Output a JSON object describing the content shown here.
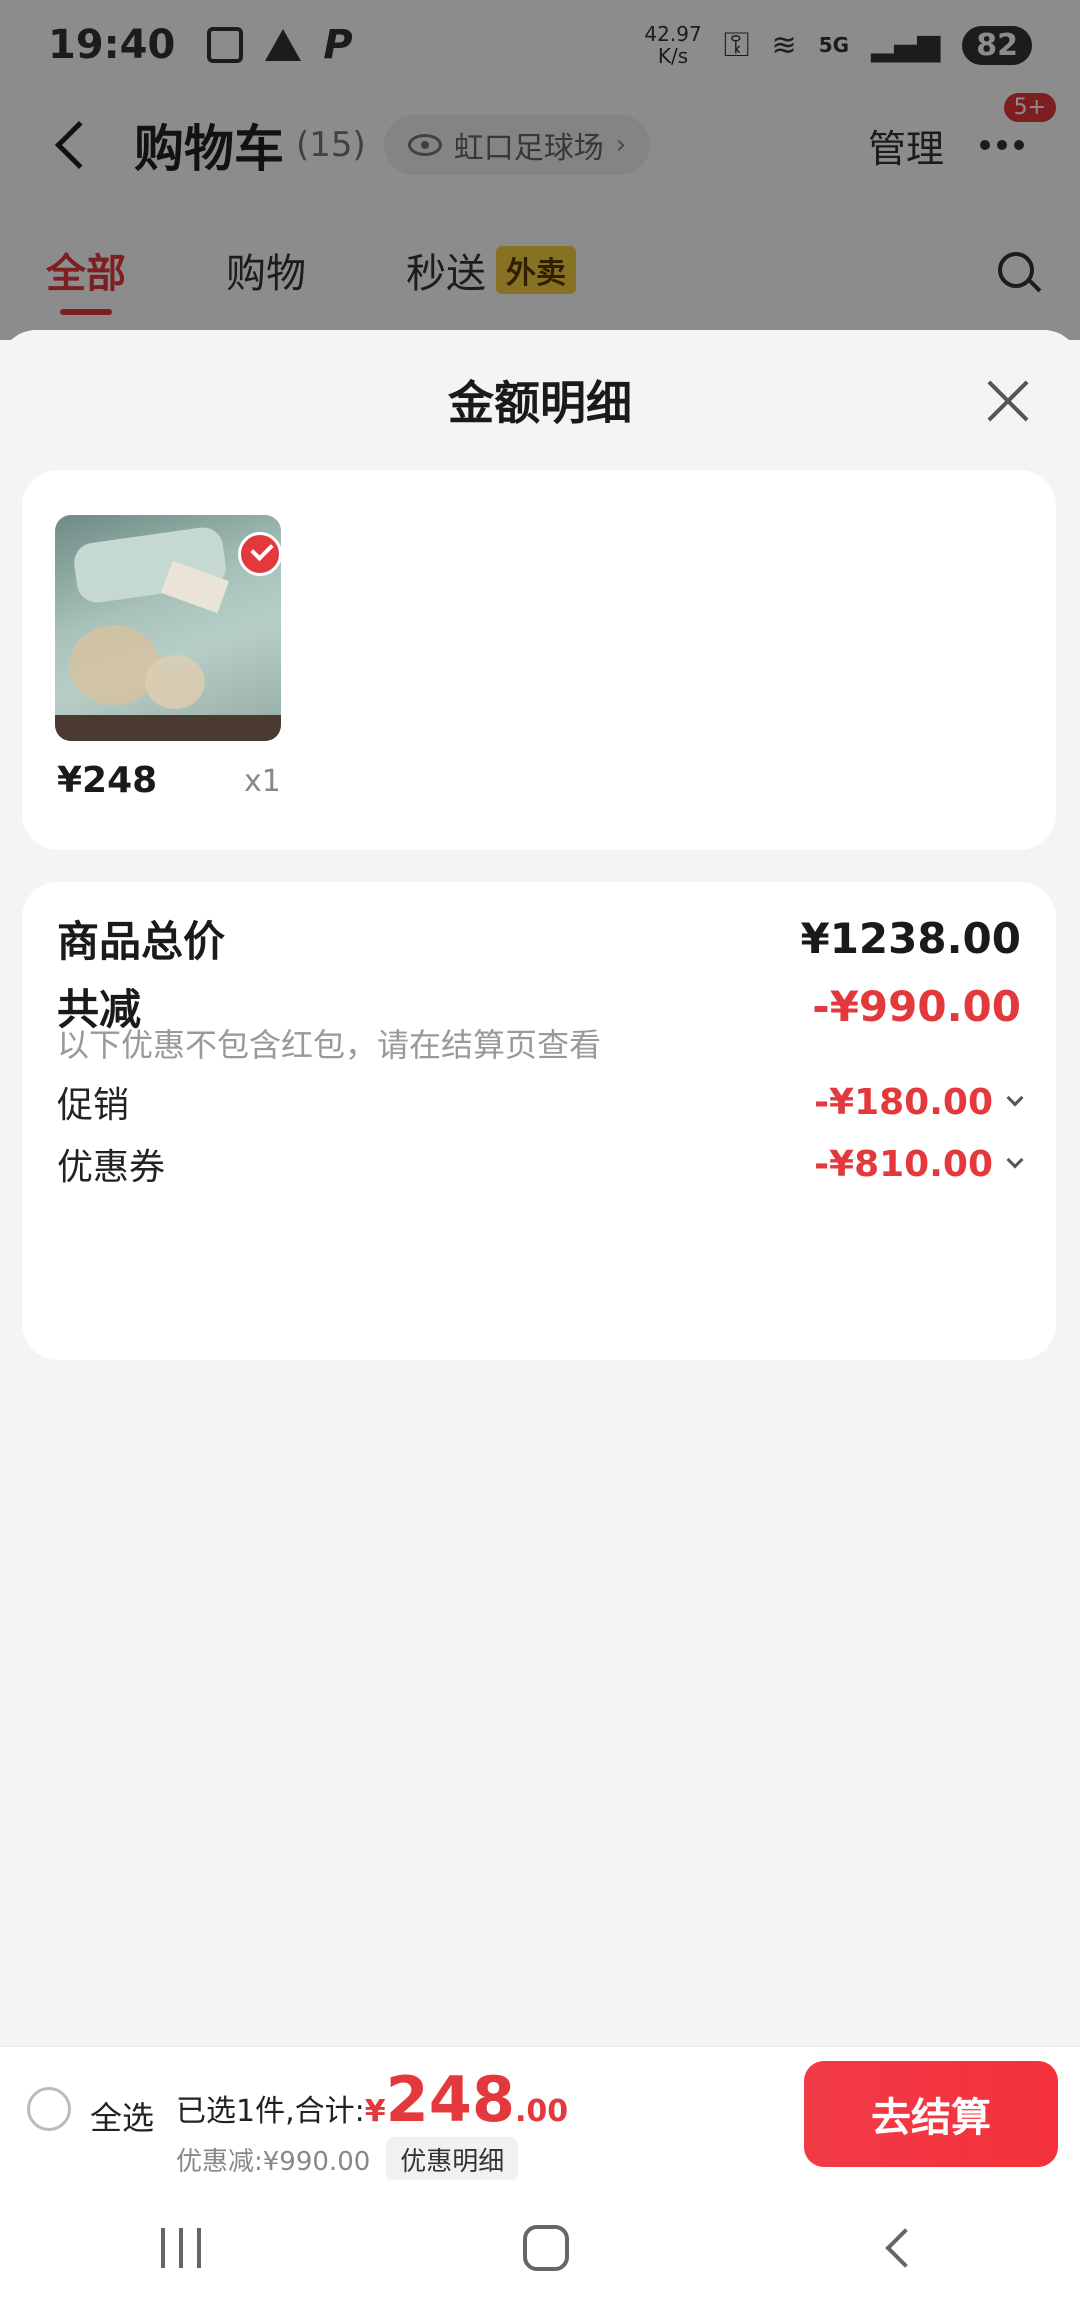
{
  "status_bar": {
    "time": "19:40",
    "net_speed_value": "42.97",
    "net_speed_unit": "K/s",
    "signal": "5G",
    "battery": "82"
  },
  "header": {
    "title": "购物车",
    "count": "(15)",
    "location": "虹口足球场",
    "manage_label": "管理",
    "more_badge": "5+"
  },
  "tabs": [
    {
      "label": "全部",
      "active": true
    },
    {
      "label": "购物",
      "active": false
    },
    {
      "label": "秒送",
      "badge": "外卖",
      "active": false
    }
  ],
  "sheet": {
    "title": "金额明细",
    "product": {
      "price": "¥248",
      "quantity": "x1"
    },
    "summary": {
      "total_label": "商品总价",
      "total_value": "¥1238.00",
      "reduce_label": "共减",
      "reduce_value": "-¥990.00",
      "note": "以下优惠不包含红包，请在结算页查看",
      "promo_label": "促销",
      "promo_value": "-¥180.00",
      "coupon_label": "优惠券",
      "coupon_value": "-¥810.00"
    }
  },
  "checkout": {
    "select_all": "全选",
    "selected_text": "已选1件,合计:",
    "yen": "¥",
    "total_int": "248",
    "total_dec": ".00",
    "discount_text": "优惠减:¥990.00",
    "discount_detail": "优惠明细",
    "button": "去结算"
  },
  "colors": {
    "accent": "#e4393c",
    "badge_yellow": "#f6d041"
  }
}
